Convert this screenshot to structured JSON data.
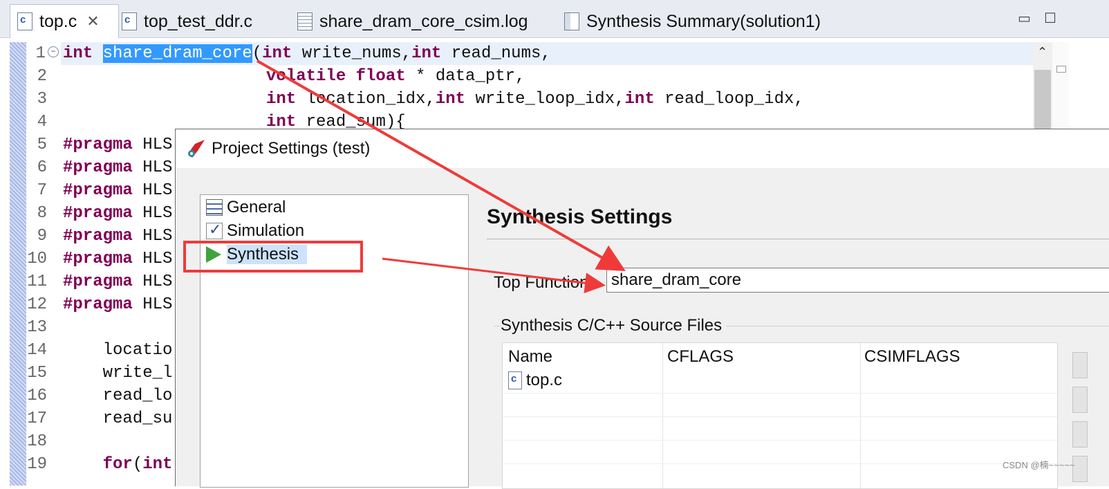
{
  "tabs": [
    {
      "label": "top.c",
      "active": true,
      "closable": true,
      "icon": "c-file-icon"
    },
    {
      "label": "top_test_ddr.c",
      "icon": "c-file-icon"
    },
    {
      "label": "share_dram_core_csim.log",
      "icon": "log-file-icon"
    },
    {
      "label": "Synthesis Summary(solution1)",
      "icon": "summary-icon"
    }
  ],
  "window": {
    "minimize": "▭",
    "maximize": "☐"
  },
  "editor": {
    "line_numbers": [
      "1",
      "2",
      "3",
      "4",
      "5",
      "6",
      "7",
      "8",
      "9",
      "10",
      "11",
      "12",
      "13",
      "14",
      "15",
      "16",
      "17",
      "18",
      "19"
    ],
    "lines": [
      {
        "kw1": "int",
        "sel": "share_dram_core",
        "a": "(",
        "kw2": "int",
        "b": " write_nums,",
        "kw3": "int",
        "c": " read_nums,"
      },
      {
        "kw1": "volatile",
        "kw2": "float",
        "b": " * data_ptr,"
      },
      {
        "kw1": "int",
        "a": " location_idx,",
        "kw2": "int",
        "b": " write_loop_idx,",
        "kw3": "int",
        "c": " read_loop_idx,"
      },
      {
        "kw1": "int",
        "a": " read_sum){"
      },
      {
        "pp": "#pragma",
        "t": " HLS"
      },
      {
        "pp": "#pragma",
        "t": " HLS"
      },
      {
        "pp": "#pragma",
        "t": " HLS"
      },
      {
        "pp": "#pragma",
        "t": " HLS"
      },
      {
        "pp": "#pragma",
        "t": " HLS"
      },
      {
        "pp": "#pragma",
        "t": " HLS"
      },
      {
        "pp": "#pragma",
        "t": " HLS"
      },
      {
        "pp": "#pragma",
        "t": " HLS"
      },
      {
        "t": ""
      },
      {
        "t": "    locatio"
      },
      {
        "t": "    write_l"
      },
      {
        "t": "    read_lo"
      },
      {
        "t": "    read_su"
      },
      {
        "t": ""
      },
      {
        "kw1": "for",
        "t": "    ",
        "a": "(",
        "kw2": "int"
      }
    ]
  },
  "dialog": {
    "title": "Project Settings (test)",
    "nav": [
      {
        "label": "General",
        "icon": "general-icon"
      },
      {
        "label": "Simulation",
        "icon": "checkbox-icon"
      },
      {
        "label": "Synthesis",
        "icon": "play-icon",
        "selected": true
      }
    ],
    "section_title": "Synthesis Settings",
    "top_function_label": "Top Function:",
    "top_function_value": "share_dram_core",
    "group_label": "Synthesis C/C++ Source Files",
    "table": {
      "headers": [
        "Name",
        "CFLAGS",
        "CSIMFLAGS"
      ],
      "rows": [
        [
          "top.c",
          "",
          ""
        ]
      ]
    }
  },
  "watermark": "CSDN @楠~~~~~",
  "colors": {
    "annotation_red": "#f03a3a",
    "keyword": "#7f0055",
    "selection": "#3399ff"
  }
}
